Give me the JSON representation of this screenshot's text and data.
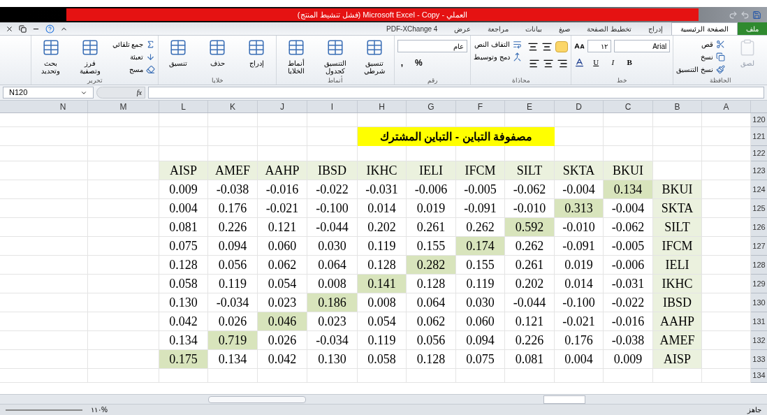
{
  "window": {
    "title": "العملي - Microsoft Excel - Copy (فشل تنشيط المنتج)"
  },
  "tabs": [
    {
      "label": "ملف",
      "kind": "file",
      "selected": false
    },
    {
      "label": "الصفحة الرئيسية",
      "kind": "tab",
      "selected": true
    },
    {
      "label": "إدراج",
      "kind": "tab",
      "selected": false
    },
    {
      "label": "تخطيط الصفحة",
      "kind": "tab",
      "selected": false
    },
    {
      "label": "صيغ",
      "kind": "tab",
      "selected": false
    },
    {
      "label": "بيانات",
      "kind": "tab",
      "selected": false
    },
    {
      "label": "مراجعة",
      "kind": "tab",
      "selected": false
    },
    {
      "label": "عرض",
      "kind": "tab",
      "selected": false
    },
    {
      "label": "PDF-XChange 4",
      "kind": "tab",
      "selected": false
    }
  ],
  "ribbon": [
    {
      "label": "الحافظة",
      "items": [
        {
          "kind": "large",
          "label": "لصق",
          "disabled": true
        },
        {
          "kind": "stack",
          "items": [
            "قص",
            "نسخ",
            "نسخ التنسيق"
          ]
        }
      ]
    },
    {
      "label": "خط",
      "items": [
        {
          "kind": "font",
          "font": "Arial",
          "size": "١٢",
          "glyphs": [
            "U",
            "I",
            "B"
          ]
        }
      ]
    },
    {
      "label": "محاذاة",
      "items": [
        {
          "kind": "align"
        },
        {
          "kind": "stack",
          "items": [
            "التفاف النص",
            "دمج وتوسيط"
          ]
        }
      ]
    },
    {
      "label": "رقم",
      "items": [
        {
          "kind": "number",
          "format": "عام",
          "glyphs": [
            ",",
            "%"
          ]
        }
      ]
    },
    {
      "label": "أنماط",
      "items": [
        {
          "kind": "large",
          "label": "تنسيق شرطي",
          "disabled": false
        },
        {
          "kind": "large",
          "label": "التنسيق كجدول",
          "disabled": false
        },
        {
          "kind": "large",
          "label": "أنماط الخلايا",
          "disabled": false
        }
      ]
    },
    {
      "label": "خلايا",
      "items": [
        {
          "kind": "large",
          "label": "إدراج",
          "disabled": false
        },
        {
          "kind": "large",
          "label": "حذف",
          "disabled": false
        },
        {
          "kind": "large",
          "label": "تنسيق",
          "disabled": false
        }
      ]
    },
    {
      "label": "تحرير",
      "items": [
        {
          "kind": "stack",
          "items": [
            "جمع تلقائي",
            "تعبئة",
            "مسح"
          ]
        },
        {
          "kind": "large",
          "label": "فرز وتصفية",
          "disabled": false
        },
        {
          "kind": "large",
          "label": "بحث وتحديد",
          "disabled": false
        }
      ]
    }
  ],
  "formula_bar": {
    "name_box": "N120",
    "fx": "fx"
  },
  "columns": [
    "N",
    "M",
    "L",
    "K",
    "J",
    "I",
    "H",
    "G",
    "F",
    "E",
    "D",
    "C",
    "B",
    "A"
  ],
  "rows": [
    {
      "number": "120",
      "kind": "blank"
    },
    {
      "number": "121",
      "kind": "title",
      "text": "مصفوفة التباين - التباين المشترك"
    },
    {
      "number": "122",
      "kind": "blank"
    },
    {
      "number": "123",
      "kind": "header",
      "labels": [
        "AISP",
        "AMEF",
        "AAHP",
        "IBSD",
        "IKHC",
        "IELI",
        "IFCM",
        "SILT",
        "SKTA",
        "BKUI"
      ]
    },
    {
      "number": "124",
      "kind": "data",
      "label": "BKUI",
      "values": [
        {
          "text": "0.009",
          "highlighted": false
        },
        {
          "text": "-0.038",
          "highlighted": false
        },
        {
          "text": "-0.016",
          "highlighted": false
        },
        {
          "text": "-0.022",
          "highlighted": false
        },
        {
          "text": "-0.031",
          "highlighted": false
        },
        {
          "text": "-0.006",
          "highlighted": false
        },
        {
          "text": "-0.005",
          "highlighted": false
        },
        {
          "text": "-0.062",
          "highlighted": false
        },
        {
          "text": "-0.004",
          "highlighted": false
        },
        {
          "text": "0.134",
          "highlighted": true
        }
      ]
    },
    {
      "number": "125",
      "kind": "data",
      "label": "SKTA",
      "values": [
        {
          "text": "0.004",
          "highlighted": false
        },
        {
          "text": "0.176",
          "highlighted": false
        },
        {
          "text": "-0.021",
          "highlighted": false
        },
        {
          "text": "-0.100",
          "highlighted": false
        },
        {
          "text": "0.014",
          "highlighted": false
        },
        {
          "text": "0.019",
          "highlighted": false
        },
        {
          "text": "-0.091",
          "highlighted": false
        },
        {
          "text": "-0.010",
          "highlighted": false
        },
        {
          "text": "0.313",
          "highlighted": true
        },
        {
          "text": "-0.004",
          "highlighted": false
        }
      ]
    },
    {
      "number": "126",
      "kind": "data",
      "label": "SILT",
      "values": [
        {
          "text": "0.081",
          "highlighted": false
        },
        {
          "text": "0.226",
          "highlighted": false
        },
        {
          "text": "0.121",
          "highlighted": false
        },
        {
          "text": "-0.044",
          "highlighted": false
        },
        {
          "text": "0.202",
          "highlighted": false
        },
        {
          "text": "0.261",
          "highlighted": false
        },
        {
          "text": "0.262",
          "highlighted": false
        },
        {
          "text": "0.592",
          "highlighted": true
        },
        {
          "text": "-0.010",
          "highlighted": false
        },
        {
          "text": "-0.062",
          "highlighted": false
        }
      ]
    },
    {
      "number": "127",
      "kind": "data",
      "label": "IFCM",
      "values": [
        {
          "text": "0.075",
          "highlighted": false
        },
        {
          "text": "0.094",
          "highlighted": false
        },
        {
          "text": "0.060",
          "highlighted": false
        },
        {
          "text": "0.030",
          "highlighted": false
        },
        {
          "text": "0.119",
          "highlighted": false
        },
        {
          "text": "0.155",
          "highlighted": false
        },
        {
          "text": "0.174",
          "highlighted": true
        },
        {
          "text": "0.262",
          "highlighted": false
        },
        {
          "text": "-0.091",
          "highlighted": false
        },
        {
          "text": "-0.005",
          "highlighted": false
        }
      ]
    },
    {
      "number": "128",
      "kind": "data",
      "label": "IELI",
      "values": [
        {
          "text": "0.128",
          "highlighted": false
        },
        {
          "text": "0.056",
          "highlighted": false
        },
        {
          "text": "0.062",
          "highlighted": false
        },
        {
          "text": "0.064",
          "highlighted": false
        },
        {
          "text": "0.128",
          "highlighted": false
        },
        {
          "text": "0.282",
          "highlighted": true
        },
        {
          "text": "0.155",
          "highlighted": false
        },
        {
          "text": "0.261",
          "highlighted": false
        },
        {
          "text": "0.019",
          "highlighted": false
        },
        {
          "text": "-0.006",
          "highlighted": false
        }
      ]
    },
    {
      "number": "129",
      "kind": "data",
      "label": "IKHC",
      "values": [
        {
          "text": "0.058",
          "highlighted": false
        },
        {
          "text": "0.119",
          "highlighted": false
        },
        {
          "text": "0.054",
          "highlighted": false
        },
        {
          "text": "0.008",
          "highlighted": false
        },
        {
          "text": "0.141",
          "highlighted": true
        },
        {
          "text": "0.128",
          "highlighted": false
        },
        {
          "text": "0.119",
          "highlighted": false
        },
        {
          "text": "0.202",
          "highlighted": false
        },
        {
          "text": "0.014",
          "highlighted": false
        },
        {
          "text": "-0.031",
          "highlighted": false
        }
      ]
    },
    {
      "number": "130",
      "kind": "data",
      "label": "IBSD",
      "values": [
        {
          "text": "0.130",
          "highlighted": false
        },
        {
          "text": "-0.034",
          "highlighted": false
        },
        {
          "text": "0.023",
          "highlighted": false
        },
        {
          "text": "0.186",
          "highlighted": true
        },
        {
          "text": "0.008",
          "highlighted": false
        },
        {
          "text": "0.064",
          "highlighted": false
        },
        {
          "text": "0.030",
          "highlighted": false
        },
        {
          "text": "-0.044",
          "highlighted": false
        },
        {
          "text": "-0.100",
          "highlighted": false
        },
        {
          "text": "-0.022",
          "highlighted": false
        }
      ]
    },
    {
      "number": "131",
      "kind": "data",
      "label": "AAHP",
      "values": [
        {
          "text": "0.042",
          "highlighted": false
        },
        {
          "text": "0.026",
          "highlighted": false
        },
        {
          "text": "0.046",
          "highlighted": true
        },
        {
          "text": "0.023",
          "highlighted": false
        },
        {
          "text": "0.054",
          "highlighted": false
        },
        {
          "text": "0.062",
          "highlighted": false
        },
        {
          "text": "0.060",
          "highlighted": false
        },
        {
          "text": "0.121",
          "highlighted": false
        },
        {
          "text": "-0.021",
          "highlighted": false
        },
        {
          "text": "-0.016",
          "highlighted": false
        }
      ]
    },
    {
      "number": "132",
      "kind": "data",
      "label": "AMEF",
      "values": [
        {
          "text": "0.134",
          "highlighted": false
        },
        {
          "text": "0.719",
          "highlighted": true
        },
        {
          "text": "0.026",
          "highlighted": false
        },
        {
          "text": "-0.034",
          "highlighted": false
        },
        {
          "text": "0.119",
          "highlighted": false
        },
        {
          "text": "0.056",
          "highlighted": false
        },
        {
          "text": "0.094",
          "highlighted": false
        },
        {
          "text": "0.226",
          "highlighted": false
        },
        {
          "text": "0.176",
          "highlighted": false
        },
        {
          "text": "-0.038",
          "highlighted": false
        }
      ]
    },
    {
      "number": "133",
      "kind": "data",
      "label": "AISP",
      "values": [
        {
          "text": "0.175",
          "highlighted": true
        },
        {
          "text": "0.134",
          "highlighted": false
        },
        {
          "text": "0.042",
          "highlighted": false
        },
        {
          "text": "0.130",
          "highlighted": false
        },
        {
          "text": "0.058",
          "highlighted": false
        },
        {
          "text": "0.128",
          "highlighted": false
        },
        {
          "text": "0.075",
          "highlighted": false
        },
        {
          "text": "0.081",
          "highlighted": false
        },
        {
          "text": "0.004",
          "highlighted": false
        },
        {
          "text": "0.009",
          "highlighted": false
        }
      ]
    },
    {
      "number": "134",
      "kind": "blank"
    }
  ],
  "status_bar": {
    "status": "جاهز",
    "zoom": "%١١٠"
  }
}
